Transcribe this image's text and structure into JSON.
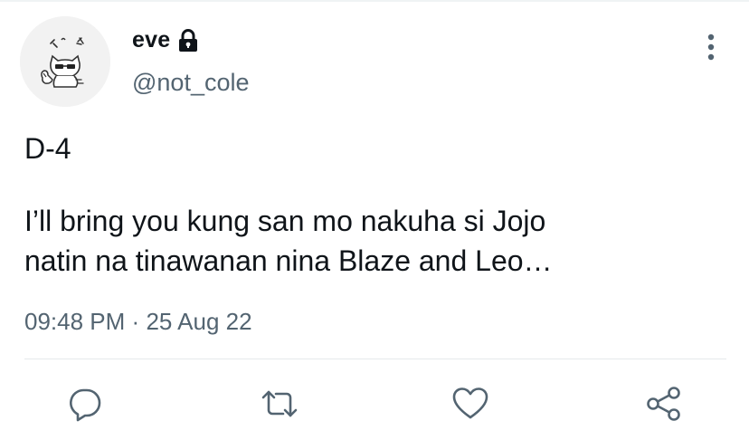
{
  "user": {
    "display_name": "eve",
    "handle": "@not_cole",
    "avatar": "avatar-cat-sketch",
    "protected_icon": "lock-icon"
  },
  "header": {
    "more_icon": "more-vertical-icon"
  },
  "tweet": {
    "line_1": "D-4",
    "body_line_1": "I’ll bring you kung san mo nakuha si Jojo",
    "body_line_2": "natin na tinawanan nina Blaze and Leo…",
    "time": "09:48 PM",
    "separator": "·",
    "date": "25 Aug 22"
  },
  "actions": [
    {
      "name": "reply",
      "icon": "reply-icon"
    },
    {
      "name": "retweet",
      "icon": "retweet-icon"
    },
    {
      "name": "like",
      "icon": "heart-icon"
    },
    {
      "name": "share",
      "icon": "share-icon"
    }
  ],
  "colors": {
    "text_primary": "#0f1419",
    "text_secondary": "#536471",
    "icon": "#536471",
    "divider": "#e6e9eb"
  }
}
